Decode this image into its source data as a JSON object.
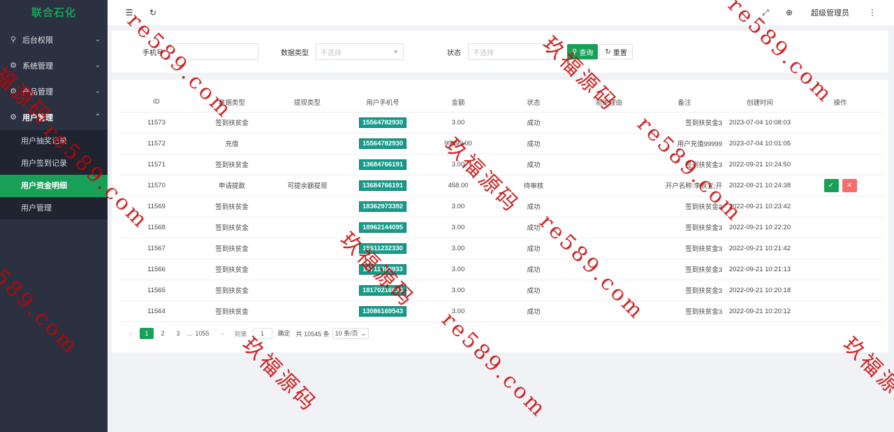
{
  "sidebar": {
    "brand": "联合石化",
    "menus": [
      {
        "label": "后台权限",
        "icon": "user-icon",
        "glyph": "⚲",
        "arrow": "⌄"
      },
      {
        "label": "系统管理",
        "icon": "settings-icon",
        "glyph": "⚙",
        "arrow": "⌄"
      },
      {
        "label": "产品管理",
        "icon": "settings-icon",
        "glyph": "⚙",
        "arrow": "⌄"
      },
      {
        "label": "用户管理",
        "icon": "gear-icon",
        "glyph": "⚙",
        "arrow": "⌃"
      }
    ],
    "submenu": [
      {
        "label": "用户抽奖记录"
      },
      {
        "label": "用户签到记录"
      },
      {
        "label": "用户资金明细"
      },
      {
        "label": "用户管理"
      }
    ]
  },
  "topbar": {
    "menu_toggle_icon": "menu-fold-icon",
    "refresh_icon": "refresh-icon",
    "fullscreen_icon": "fullscreen-icon",
    "language_icon": "globe-icon",
    "user_name": "超级管理员",
    "more_icon": "more-vertical-icon"
  },
  "filter": {
    "phone_label": "手机号",
    "phone_value": "",
    "data_type_label": "数据类型",
    "data_type_placeholder": "不选择",
    "status_label": "状态",
    "status_placeholder": "不选择",
    "search_label": "查询",
    "reset_label": "重置"
  },
  "table": {
    "columns": [
      "ID",
      "数据类型",
      "提现类型",
      "用户手机号",
      "金额",
      "状态",
      "拒绝理由",
      "备注",
      "创建时间",
      "操作"
    ],
    "rows": [
      {
        "id": "11573",
        "type": "签到扶贫金",
        "withdraw_type": "",
        "phone": "15564782930",
        "amount": "3.00",
        "status": "成功",
        "reason": "",
        "remark": "签到扶贫金3",
        "time": "2023-07-04 10:08:03",
        "actions": false
      },
      {
        "id": "11572",
        "type": "充值",
        "withdraw_type": "",
        "phone": "15564782930",
        "amount": "99999.00",
        "status": "成功",
        "reason": "",
        "remark": "用户充值99999",
        "time": "2023-07-04 10:01:05",
        "actions": false
      },
      {
        "id": "11571",
        "type": "签到扶贫金",
        "withdraw_type": "",
        "phone": "13684766191",
        "amount": "3.00",
        "status": "成功",
        "reason": "",
        "remark": "签到扶贫金3",
        "time": "2022-09-21 10:24:50",
        "actions": false
      },
      {
        "id": "11570",
        "type": "申请提款",
        "withdraw_type": "可提余额提现",
        "phone": "13684766191",
        "amount": "458.00",
        "status": "待审核",
        "reason": "",
        "remark": "开户名称:李秋立;开",
        "time": "2022-09-21 10:24:38",
        "actions": true
      },
      {
        "id": "11569",
        "type": "签到扶贫金",
        "withdraw_type": "",
        "phone": "18362973392",
        "amount": "3.00",
        "status": "成功",
        "reason": "",
        "remark": "签到扶贫金3",
        "time": "2022-09-21 10:23:42",
        "actions": false
      },
      {
        "id": "11568",
        "type": "签到扶贫金",
        "withdraw_type": "",
        "phone": "18962144095",
        "amount": "3.00",
        "status": "成功",
        "reason": "",
        "remark": "签到扶贫金3",
        "time": "2022-09-21 10:22:20",
        "actions": false
      },
      {
        "id": "11567",
        "type": "签到扶贫金",
        "withdraw_type": "",
        "phone": "15611232330",
        "amount": "3.00",
        "status": "成功",
        "reason": "",
        "remark": "签到扶贫金3",
        "time": "2022-09-21 10:21:42",
        "actions": false
      },
      {
        "id": "11566",
        "type": "签到扶贫金",
        "withdraw_type": "",
        "phone": "15711393933",
        "amount": "3.00",
        "status": "成功",
        "reason": "",
        "remark": "签到扶贫金3",
        "time": "2022-09-21 10:21:13",
        "actions": false
      },
      {
        "id": "11565",
        "type": "签到扶贫金",
        "withdraw_type": "",
        "phone": "18170216033",
        "amount": "3.00",
        "status": "成功",
        "reason": "",
        "remark": "签到扶贫金3",
        "time": "2022-09-21 10:20:18",
        "actions": false
      },
      {
        "id": "11564",
        "type": "签到扶贫金",
        "withdraw_type": "",
        "phone": "13086169543",
        "amount": "3.00",
        "status": "成功",
        "reason": "",
        "remark": "签到扶贫金3",
        "time": "2022-09-21 10:20:12",
        "actions": false
      }
    ],
    "approve_icon": "check-icon",
    "reject_icon": "close-icon"
  },
  "pagination": {
    "prev": "‹",
    "pages": [
      "1",
      "2",
      "3"
    ],
    "ellipsis": "...",
    "last": "1055",
    "next": "›",
    "goto_label": "到第",
    "goto_value": "1",
    "confirm_label": "确定",
    "total_text": "共 10545 条",
    "page_size": "10 条/页"
  },
  "watermark": {
    "brand": "玖福源码",
    "url": "re589.com"
  },
  "colors": {
    "accent": "#18a058",
    "sidebar": "#2b3140",
    "phone_tag": "#149c8b",
    "danger": "#f76c6c",
    "watermark": "#c80000"
  }
}
